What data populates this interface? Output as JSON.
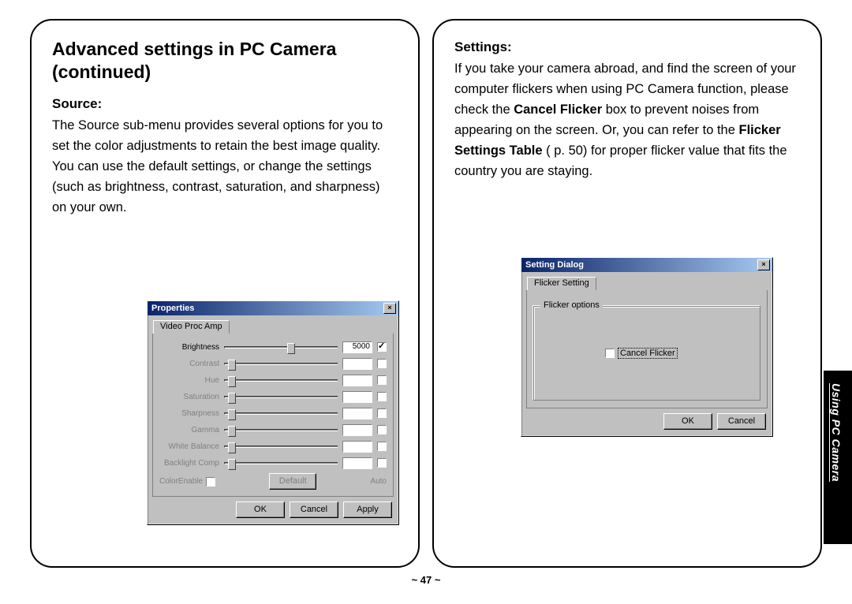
{
  "left": {
    "title": "Advanced settings in PC Camera (continued)",
    "sourceHeading": "Source:",
    "sourcePara": "The Source sub-menu provides several options for you to set the color adjustments to retain the best image quality. You can use the default settings, or change the settings (such as brightness, contrast, saturation, and sharpness) on your own.",
    "propertiesDialog": {
      "title": "Properties",
      "tab": "Video Proc Amp",
      "sliders": [
        {
          "label": "Brightness",
          "enabled": true,
          "value": "5000",
          "pos": 55,
          "checked": true
        },
        {
          "label": "Contrast",
          "enabled": false,
          "value": "",
          "pos": 3,
          "checked": false
        },
        {
          "label": "Hue",
          "enabled": false,
          "value": "",
          "pos": 3,
          "checked": false
        },
        {
          "label": "Saturation",
          "enabled": false,
          "value": "",
          "pos": 3,
          "checked": false
        },
        {
          "label": "Sharpness",
          "enabled": false,
          "value": "",
          "pos": 3,
          "checked": false
        },
        {
          "label": "Gamma",
          "enabled": false,
          "value": "",
          "pos": 3,
          "checked": false
        },
        {
          "label": "White Balance",
          "enabled": false,
          "value": "",
          "pos": 3,
          "checked": false
        },
        {
          "label": "Backlight Comp",
          "enabled": false,
          "value": "",
          "pos": 3,
          "checked": false
        }
      ],
      "colorEnable": "ColorEnable",
      "defaultBtn": "Default",
      "autoLabel": "Auto",
      "buttons": {
        "ok": "OK",
        "cancel": "Cancel",
        "apply": "Apply"
      }
    }
  },
  "right": {
    "settingsHeading": "Settings:",
    "settingsPara1": "If you take your camera abroad, and find the screen of your computer flickers when using PC Camera function, please check the ",
    "bold1": "Cancel Flicker",
    "settingsPara2": " box to prevent noises from appearing on the screen. Or, you can refer to the ",
    "bold2": "Flicker Settings Table",
    "settingsPara3": " p. 50) for proper flicker value that fits the country you are staying.",
    "settingDialog": {
      "title": "Setting Dialog",
      "tab": "Flicker Setting",
      "group": "Flicker options",
      "checkboxLabel": "Cancel Flicker",
      "buttons": {
        "ok": "OK",
        "cancel": "Cancel"
      }
    }
  },
  "pageNumber": "~ 47 ~",
  "sideTab": "Using PC Camera"
}
